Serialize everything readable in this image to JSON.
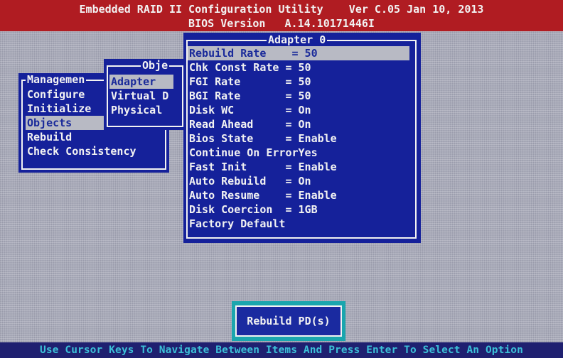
{
  "header": {
    "title_line": "Embedded RAID II Configuration Utility    Ver C.05 Jan 10, 2013",
    "bios_line": "BIOS Version   A.14.10171446I"
  },
  "management_menu": {
    "title": "Managemen",
    "items": [
      {
        "label": "Configure",
        "selected": false
      },
      {
        "label": "Initialize",
        "selected": false
      },
      {
        "label": "Objects",
        "selected": true
      },
      {
        "label": "Rebuild",
        "selected": false
      },
      {
        "label": "Check Consistency",
        "selected": false
      }
    ]
  },
  "objects_menu": {
    "title": "Obje",
    "items": [
      {
        "label": "Adapter",
        "selected": true
      },
      {
        "label": "Virtual D",
        "selected": false
      },
      {
        "label": "Physical",
        "selected": false
      }
    ]
  },
  "adapter_menu": {
    "title": "Adapter 0",
    "items": [
      {
        "label": "Rebuild Rate    = 50",
        "selected": true
      },
      {
        "label": "Chk Const Rate = 50",
        "selected": false
      },
      {
        "label": "FGI Rate       = 50",
        "selected": false
      },
      {
        "label": "BGI Rate       = 50",
        "selected": false
      },
      {
        "label": "Disk WC        = On",
        "selected": false
      },
      {
        "label": "Read Ahead     = On",
        "selected": false
      },
      {
        "label": "Bios State     = Enable",
        "selected": false
      },
      {
        "label": "Continue On ErrorYes",
        "selected": false
      },
      {
        "label": "Fast Init      = Enable",
        "selected": false
      },
      {
        "label": "Auto Rebuild   = On",
        "selected": false
      },
      {
        "label": "Auto Resume    = Enable",
        "selected": false
      },
      {
        "label": "Disk Coercion  = 1GB",
        "selected": false
      },
      {
        "label": "Factory Default",
        "selected": false
      }
    ]
  },
  "status_box": {
    "label": "Rebuild PD(s)"
  },
  "footer": {
    "hint": "Use Cursor Keys To Navigate Between Items And Press Enter To Select An Option"
  },
  "colors": {
    "header_bg": "#b01c22",
    "window_bg": "#15219a",
    "selection_bg": "#b8bac4",
    "footer_text": "#3cc0d8",
    "status_box_bg": "#1aa6ae"
  }
}
